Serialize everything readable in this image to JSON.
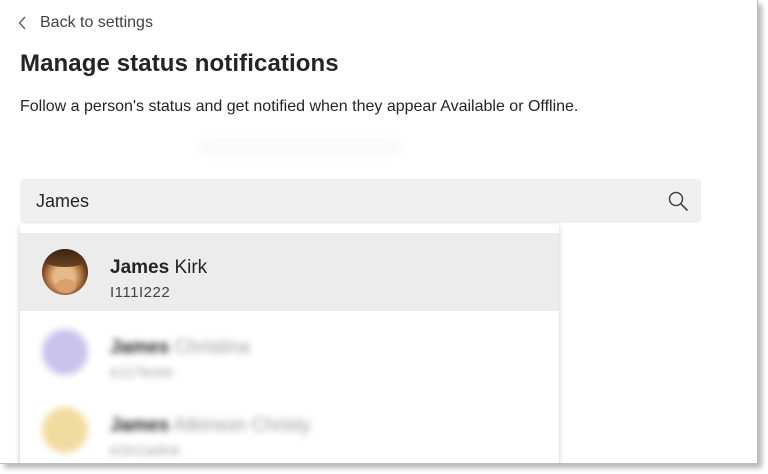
{
  "nav": {
    "back_label": "Back to settings"
  },
  "page": {
    "title": "Manage status notifications",
    "description": "Follow a person's status and get notified when they appear Available or Offline."
  },
  "search": {
    "value": "James"
  },
  "results": [
    {
      "match": "James",
      "rest": " Kirk",
      "subtitle": "I111I222",
      "selected": true
    },
    {
      "match": "James",
      "rest": " Christina",
      "subtitle": "e11Teste",
      "selected": false
    },
    {
      "match": "James",
      "rest": " Atkinson Christy",
      "subtitle": "e2e1adne",
      "selected": false
    }
  ]
}
